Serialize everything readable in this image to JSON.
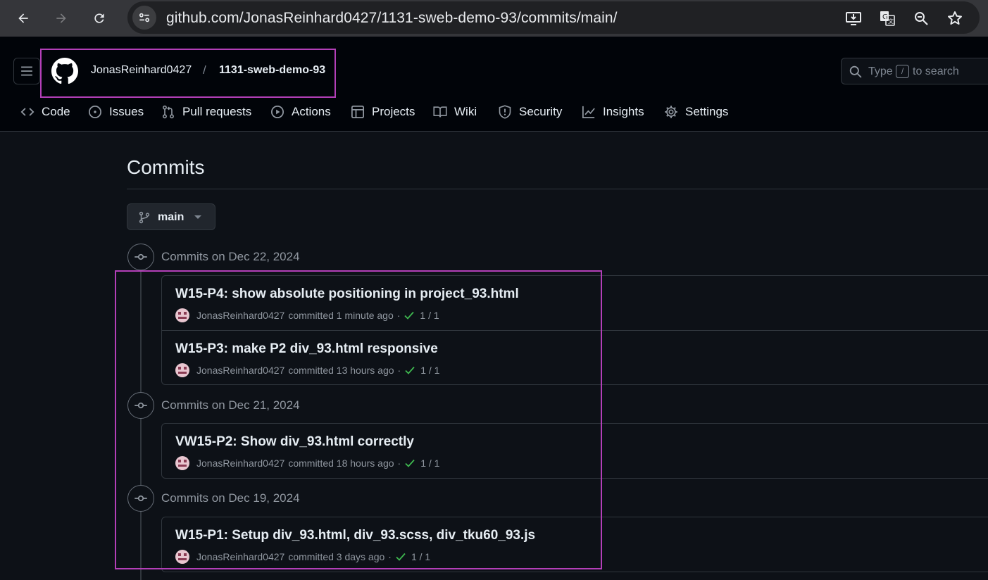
{
  "browser": {
    "url": "github.com/JonasReinhard0427/1131-sweb-demo-93/commits/main/"
  },
  "header": {
    "owner": "JonasReinhard0427",
    "separator": "/",
    "repo": "1131-sweb-demo-93",
    "search": {
      "type_text": "Type",
      "key": "/",
      "rest_text": "to search"
    }
  },
  "tabs": [
    {
      "label": "Code",
      "icon": "code-icon"
    },
    {
      "label": "Issues",
      "icon": "issue-icon"
    },
    {
      "label": "Pull requests",
      "icon": "pull-request-icon"
    },
    {
      "label": "Actions",
      "icon": "play-icon"
    },
    {
      "label": "Projects",
      "icon": "table-icon"
    },
    {
      "label": "Wiki",
      "icon": "book-icon"
    },
    {
      "label": "Security",
      "icon": "shield-icon"
    },
    {
      "label": "Insights",
      "icon": "graph-icon"
    },
    {
      "label": "Settings",
      "icon": "gear-icon"
    }
  ],
  "page": {
    "title": "Commits",
    "branch": "main"
  },
  "groups": [
    {
      "date_label": "Commits on Dec 22, 2024",
      "commits": [
        {
          "message": "W15-P4: show absolute positioning in project_93.html",
          "author": "JonasReinhard0427",
          "action": "committed",
          "time": "1 minute ago",
          "dot": "·",
          "checks": "1 / 1"
        },
        {
          "message": "W15-P3: make P2 div_93.html responsive",
          "author": "JonasReinhard0427",
          "action": "committed",
          "time": "13 hours ago",
          "dot": "·",
          "checks": "1 / 1"
        }
      ]
    },
    {
      "date_label": "Commits on Dec 21, 2024",
      "commits": [
        {
          "message": "VW15-P2: Show div_93.html correctly",
          "author": "JonasReinhard0427",
          "action": "committed",
          "time": "18 hours ago",
          "dot": "·",
          "checks": "1 / 1"
        }
      ]
    },
    {
      "date_label": "Commits on Dec 19, 2024",
      "commits": [
        {
          "message": "W15-P1: Setup div_93.html, div_93.scss, div_tku60_93.js",
          "author": "JonasReinhard0427",
          "action": "committed",
          "time": "3 days ago",
          "dot": "·",
          "checks": "1 / 1"
        }
      ]
    }
  ],
  "colors": {
    "highlight": "#b33fb8",
    "success": "#3fb950",
    "background": "#0d1117"
  }
}
